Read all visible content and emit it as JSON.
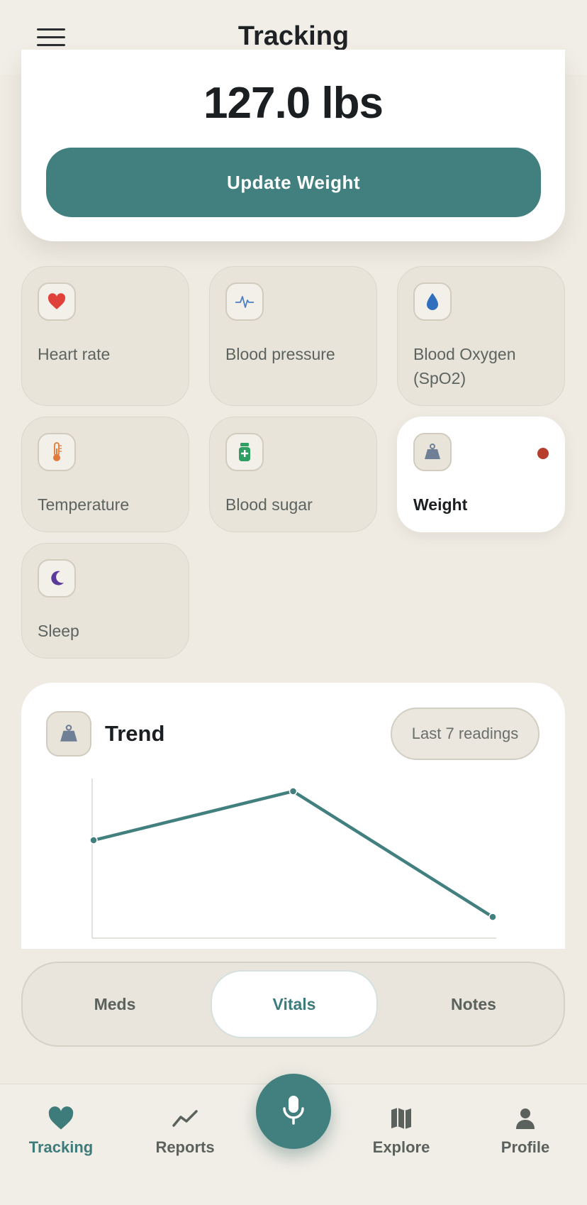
{
  "header": {
    "title": "Tracking",
    "menu_icon": "hamburger-menu-icon"
  },
  "weight_card": {
    "value": "127.0 lbs",
    "update_button": "Update Weight"
  },
  "vitals": [
    {
      "label": "Heart rate",
      "icon": "heart-icon",
      "icon_color": "#e0413b"
    },
    {
      "label": "Blood pressure",
      "icon": "pulse-icon",
      "icon_color": "#4f7fc3"
    },
    {
      "label": "Blood Oxygen (SpO2)",
      "icon": "water-drop-icon",
      "icon_color": "#2f6fbd"
    },
    {
      "label": "Temperature",
      "icon": "thermometer-icon",
      "icon_color": "#e07a3a"
    },
    {
      "label": "Blood sugar",
      "icon": "medicine-bottle-icon",
      "icon_color": "#2f9e63"
    },
    {
      "label": "Weight",
      "icon": "weight-icon",
      "icon_color": "#6f7f96",
      "selected": true,
      "indicator_color": "#b63d2b"
    },
    {
      "label": "Sleep",
      "icon": "moon-icon",
      "icon_color": "#5b3a9c"
    }
  ],
  "trend": {
    "title": "Trend",
    "range_label": "Last 7 readings",
    "chart_data": {
      "type": "line",
      "x": [
        1,
        2,
        3
      ],
      "series": [
        {
          "values": [
            0.6,
            0.9,
            0.13
          ]
        }
      ],
      "color": "#42807f",
      "grid": false
    }
  },
  "segments": {
    "items": [
      "Meds",
      "Vitals",
      "Notes"
    ],
    "selected": "Vitals"
  },
  "bottom_nav": {
    "items": [
      {
        "label": "Tracking",
        "icon": "heart-icon",
        "active": true
      },
      {
        "label": "Reports",
        "icon": "trend-line-icon"
      },
      {
        "label": "Explore",
        "icon": "map-icon"
      },
      {
        "label": "Profile",
        "icon": "person-icon"
      }
    ],
    "mic_icon": "microphone-icon",
    "accent": "#42807f"
  }
}
